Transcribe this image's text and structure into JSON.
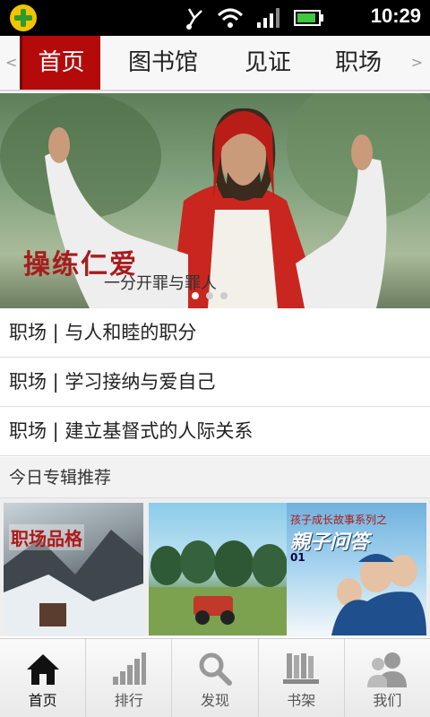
{
  "status_bar": {
    "time": "10:29",
    "icons": [
      "app-plus-icon",
      "no-usb-icon",
      "wifi-icon",
      "signal-icon",
      "battery-icon"
    ]
  },
  "tabs": [
    {
      "label": "首页",
      "active": true
    },
    {
      "label": "图书馆",
      "active": false
    },
    {
      "label": "见证",
      "active": false
    },
    {
      "label": "职场",
      "active": false
    }
  ],
  "banner": {
    "title": "操练仁爱",
    "subtitle": "一分开罪与罪人",
    "pages": 3,
    "current_page": 1
  },
  "articles": [
    {
      "title": "职场 | 与人和睦的职分"
    },
    {
      "title": "职场 | 学习接纳与爱自己"
    },
    {
      "title": "职场 | 建立基督式的人际关系"
    }
  ],
  "section": {
    "title": "今日专辑推荐"
  },
  "featured": [
    {
      "label": "职场品格"
    },
    {
      "label": ""
    },
    {
      "series": "孩子成长故事系列之",
      "label": "親子问答",
      "number": "01"
    }
  ],
  "bottom_nav": [
    {
      "label": "首页",
      "icon": "home-icon",
      "active": true
    },
    {
      "label": "排行",
      "icon": "ranking-icon",
      "active": false
    },
    {
      "label": "发现",
      "icon": "search-icon",
      "active": false
    },
    {
      "label": "书架",
      "icon": "bookshelf-icon",
      "active": false
    },
    {
      "label": "我们",
      "icon": "users-icon",
      "active": false
    }
  ],
  "colors": {
    "accent": "#b40a0a",
    "status_bar_bg": "#000000"
  }
}
